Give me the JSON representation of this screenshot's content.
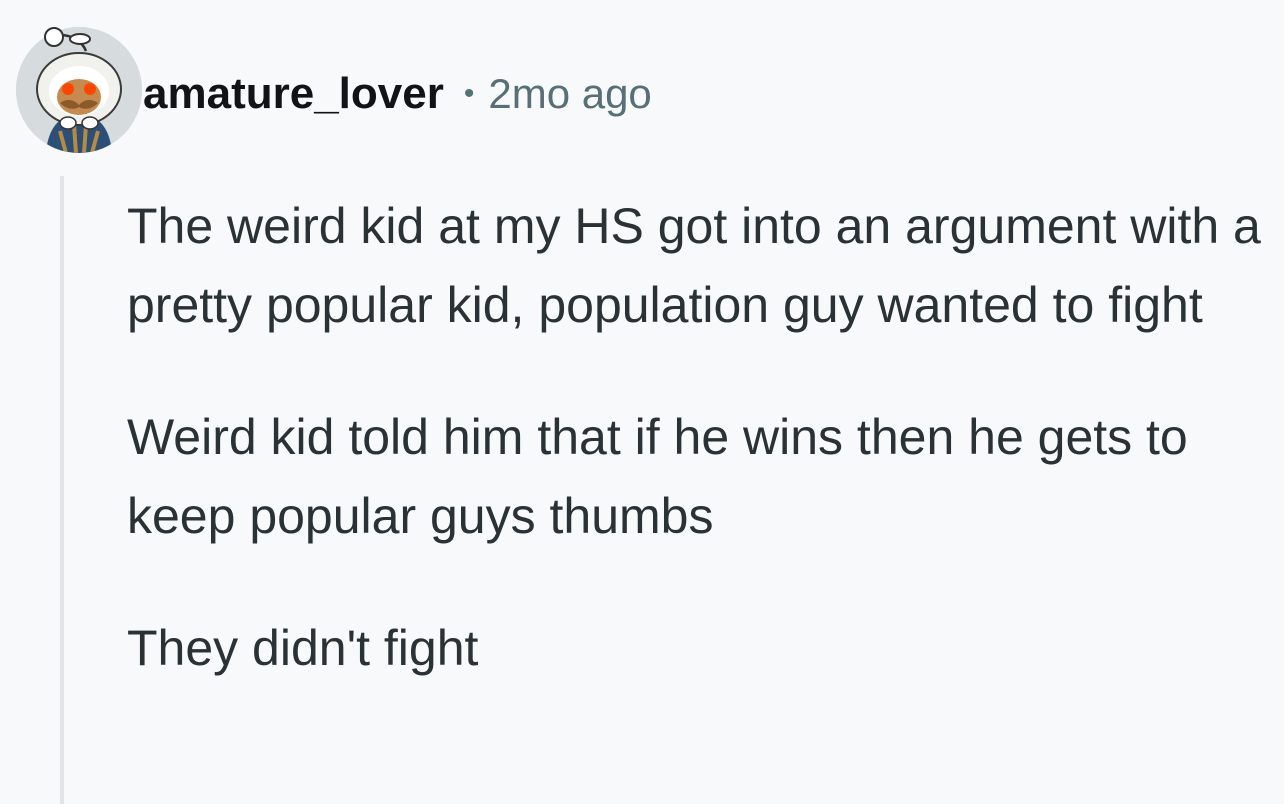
{
  "comment": {
    "author": "amature_lover",
    "separator": "•",
    "timestamp": "2mo ago",
    "avatar_icon": "snoo-avatar-icon",
    "paragraphs": [
      "The weird kid at my HS got into an argument with a pretty popular kid, population guy wanted to fight",
      "Weird kid told him that if he wins then he gets to keep popular guys thumbs",
      "They didn't fight"
    ]
  },
  "colors": {
    "background": "#f7f9fa",
    "username": "#111416",
    "meta_text": "#576f76",
    "body_text": "#2a3236",
    "thread_line": "#e1e5e8"
  }
}
